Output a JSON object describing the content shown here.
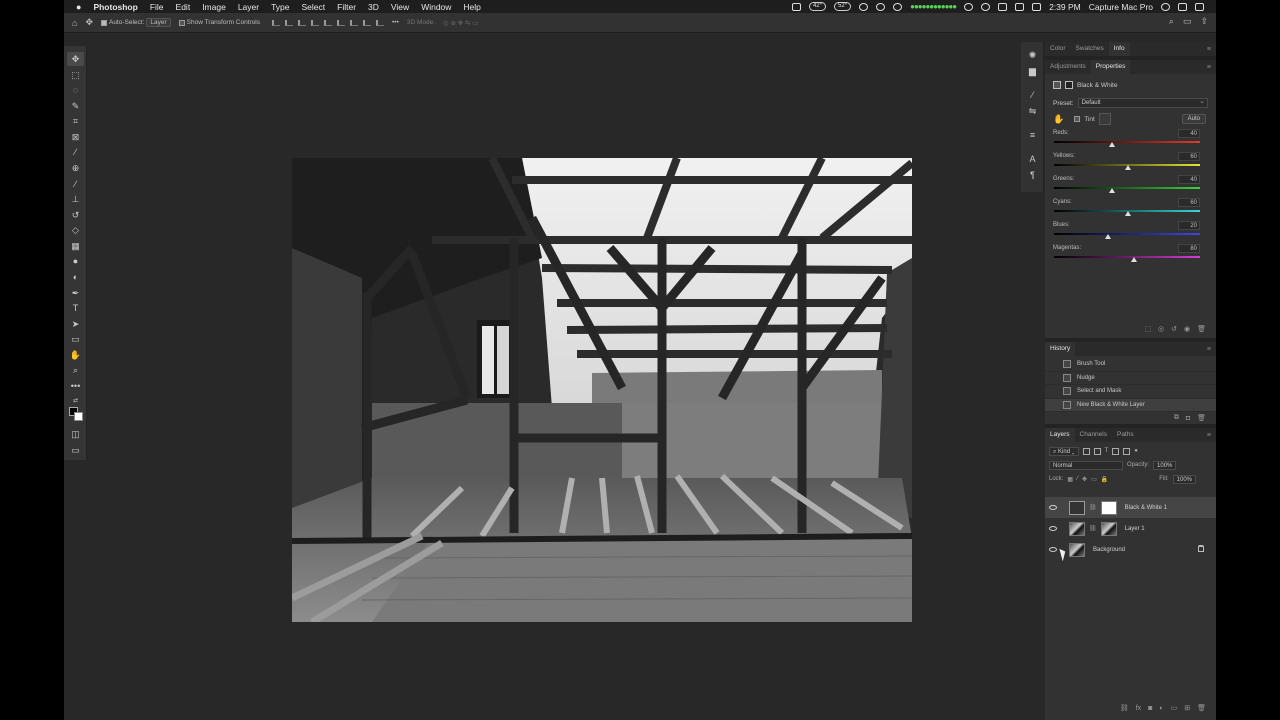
{
  "menubar": {
    "app_name": "Photoshop",
    "menus": [
      "File",
      "Edit",
      "Image",
      "Layer",
      "Type",
      "Select",
      "Filter",
      "3D",
      "View",
      "Window",
      "Help"
    ],
    "status": {
      "cpu_temp": "42°",
      "gpu_temp": "52°",
      "clock": "2:39 PM",
      "capture_label": "Capture Mac Pro"
    }
  },
  "options_bar": {
    "auto_select_label": "Auto-Select:",
    "auto_select_value": "Layer",
    "show_transform_label": "Show Transform Controls",
    "mode_3d_label": "3D Mode:"
  },
  "properties_panel": {
    "top_tabs": [
      "Color",
      "Swatches",
      "Info"
    ],
    "active_top_tab": "Info",
    "tabs": [
      "Adjustments",
      "Properties"
    ],
    "active_tab": "Properties",
    "adjustment_name": "Black & White",
    "preset_label": "Preset:",
    "preset_value": "Default",
    "tint_label": "Tint",
    "auto_label": "Auto",
    "sliders": [
      {
        "label": "Reds:",
        "value": "40",
        "fraction": 0.4,
        "gradient": "linear-gradient(90deg,#000,#e03a2a)"
      },
      {
        "label": "Yellows:",
        "value": "60",
        "fraction": 0.51,
        "gradient": "linear-gradient(90deg,#000,#e8e332)"
      },
      {
        "label": "Greens:",
        "value": "40",
        "fraction": 0.4,
        "gradient": "linear-gradient(90deg,#000,#3bd23b)"
      },
      {
        "label": "Cyans:",
        "value": "60",
        "fraction": 0.51,
        "gradient": "linear-gradient(90deg,#000,#35d6d6)"
      },
      {
        "label": "Blues:",
        "value": "20",
        "fraction": 0.37,
        "gradient": "linear-gradient(90deg,#000,#3a47e6)"
      },
      {
        "label": "Magentas:",
        "value": "80",
        "fraction": 0.55,
        "gradient": "linear-gradient(90deg,#000,#d83ad8)"
      }
    ]
  },
  "history_panel": {
    "title": "History",
    "items": [
      "Brush Tool",
      "Nudge",
      "Select and Mask",
      "New Black & White Layer"
    ],
    "current_index": 3
  },
  "layers_panel": {
    "tabs": [
      "Layers",
      "Channels",
      "Paths"
    ],
    "active_tab": "Layers",
    "filter_label": "Kind",
    "blend_mode": "Normal",
    "opacity_label": "Opacity:",
    "opacity_value": "100%",
    "lock_label": "Lock:",
    "fill_label": "Fill:",
    "fill_value": "100%",
    "layers": [
      {
        "name": "Black & White 1",
        "kind": "adjustment",
        "selected": true
      },
      {
        "name": "Layer 1",
        "kind": "masked",
        "selected": false
      },
      {
        "name": "Background",
        "kind": "background",
        "selected": false
      }
    ]
  },
  "colors": {
    "app_bg": "#282828",
    "panel_bg": "#323232",
    "accent_selected": "#454545"
  }
}
